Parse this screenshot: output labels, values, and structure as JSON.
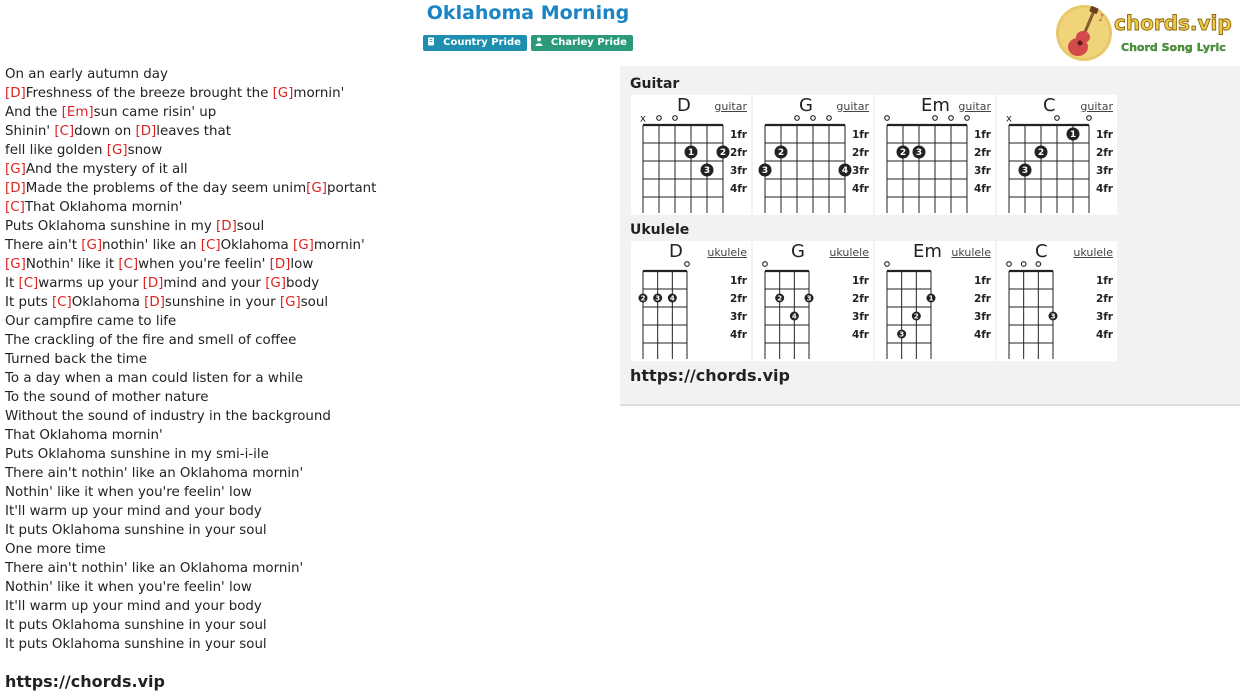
{
  "song": {
    "title": "Oklahoma Morning"
  },
  "badges": {
    "genre": "Country Pride",
    "artist": "Charley Pride"
  },
  "logo": {
    "brand": "chords.vip",
    "tagline": "Chord Song Lyric"
  },
  "lyrics": {
    "lines": [
      [
        {
          "t": "On an early autumn day"
        }
      ],
      [
        {
          "c": "[D]"
        },
        {
          "t": "Freshness of the breeze brought the "
        },
        {
          "c": "[G]"
        },
        {
          "t": "mornin'"
        }
      ],
      [
        {
          "t": "And the "
        },
        {
          "c": "[Em]"
        },
        {
          "t": "sun came risin' up"
        }
      ],
      [
        {
          "t": "Shinin' "
        },
        {
          "c": "[C]"
        },
        {
          "t": "down on "
        },
        {
          "c": "[D]"
        },
        {
          "t": "leaves that"
        }
      ],
      [
        {
          "t": "fell like golden "
        },
        {
          "c": "[G]"
        },
        {
          "t": "snow"
        }
      ],
      [
        {
          "c": "[G]"
        },
        {
          "t": "And the mystery of it all"
        }
      ],
      [
        {
          "c": "[D]"
        },
        {
          "t": "Made the problems of the day seem unim"
        },
        {
          "c": "[G]"
        },
        {
          "t": "portant"
        }
      ],
      [
        {
          "c": "[C]"
        },
        {
          "t": "That Oklahoma mornin'"
        }
      ],
      [
        {
          "t": "Puts Oklahoma sunshine in my "
        },
        {
          "c": "[D]"
        },
        {
          "t": "soul"
        }
      ],
      [
        {
          "t": "There ain't "
        },
        {
          "c": "[G]"
        },
        {
          "t": "nothin' like an "
        },
        {
          "c": "[C]"
        },
        {
          "t": "Oklahoma "
        },
        {
          "c": "[G]"
        },
        {
          "t": "mornin'"
        }
      ],
      [
        {
          "c": "[G]"
        },
        {
          "t": "Nothin' like it "
        },
        {
          "c": "[C]"
        },
        {
          "t": "when you're feelin' "
        },
        {
          "c": "[D]"
        },
        {
          "t": "low"
        }
      ],
      [
        {
          "t": "It "
        },
        {
          "c": "[C]"
        },
        {
          "t": "warms up your "
        },
        {
          "c": "[D]"
        },
        {
          "t": "mind and your "
        },
        {
          "c": "[G]"
        },
        {
          "t": "body"
        }
      ],
      [
        {
          "t": "It puts "
        },
        {
          "c": "[C]"
        },
        {
          "t": "Oklahoma "
        },
        {
          "c": "[D]"
        },
        {
          "t": "sunshine in your "
        },
        {
          "c": "[G]"
        },
        {
          "t": "soul"
        }
      ],
      [
        {
          "t": "Our campfire came to life"
        }
      ],
      [
        {
          "t": "The crackling of the fire and smell of coffee"
        }
      ],
      [
        {
          "t": "Turned back the time"
        }
      ],
      [
        {
          "t": "To a day when a man could listen for a while"
        }
      ],
      [
        {
          "t": "To the sound of mother nature"
        }
      ],
      [
        {
          "t": "Without the sound of industry in the background"
        }
      ],
      [
        {
          "t": "That Oklahoma mornin'"
        }
      ],
      [
        {
          "t": "Puts Oklahoma sunshine in my smi-i-ile"
        }
      ],
      [
        {
          "t": "There ain't nothin' like an Oklahoma mornin'"
        }
      ],
      [
        {
          "t": "Nothin' like it when you're feelin' low"
        }
      ],
      [
        {
          "t": "It'll warm up your mind and your body"
        }
      ],
      [
        {
          "t": "It puts Oklahoma sunshine in your soul"
        }
      ],
      [
        {
          "t": "One more time"
        }
      ],
      [
        {
          "t": "There ain't nothin' like an Oklahoma mornin'"
        }
      ],
      [
        {
          "t": "Nothin' like it when you're feelin' low"
        }
      ],
      [
        {
          "t": "It'll warm up your mind and your body"
        }
      ],
      [
        {
          "t": "It puts Oklahoma sunshine in your soul"
        }
      ],
      [
        {
          "t": "It puts Oklahoma sunshine in your soul"
        }
      ]
    ],
    "source_url": "https://chords.vip"
  },
  "chords_panel": {
    "guitar_label": "Guitar",
    "ukulele_label": "Ukulele",
    "source_url": "https://chords.vip",
    "fret_labels": [
      "1fr",
      "2fr",
      "3fr",
      "4fr"
    ],
    "guitar": [
      {
        "name": "D",
        "link": "guitar",
        "marks": [
          "x",
          "o",
          "o",
          "",
          "",
          ""
        ],
        "dots": [
          [
            3,
            2,
            "1"
          ],
          [
            5,
            2,
            "2"
          ],
          [
            4,
            3,
            "3"
          ]
        ]
      },
      {
        "name": "G",
        "link": "guitar",
        "marks": [
          "",
          "",
          "o",
          "o",
          "o",
          ""
        ],
        "dots": [
          [
            1,
            2,
            "2"
          ],
          [
            0,
            3,
            "3"
          ],
          [
            5,
            3,
            "4"
          ]
        ]
      },
      {
        "name": "Em",
        "link": "guitar",
        "marks": [
          "o",
          "",
          "",
          "o",
          "o",
          "o"
        ],
        "dots": [
          [
            1,
            2,
            "2"
          ],
          [
            2,
            2,
            "3"
          ]
        ]
      },
      {
        "name": "C",
        "link": "guitar",
        "marks": [
          "x",
          "",
          "",
          "o",
          "",
          "o"
        ],
        "dots": [
          [
            4,
            1,
            "1"
          ],
          [
            2,
            2,
            "2"
          ],
          [
            1,
            3,
            "3"
          ]
        ]
      }
    ],
    "ukulele": [
      {
        "name": "D",
        "link": "ukulele",
        "marks": [
          "",
          "",
          "",
          "o"
        ],
        "dots": [
          [
            0,
            2,
            "2"
          ],
          [
            1,
            2,
            "3"
          ],
          [
            2,
            2,
            "4"
          ]
        ]
      },
      {
        "name": "G",
        "link": "ukulele",
        "marks": [
          "o",
          "",
          "",
          ""
        ],
        "dots": [
          [
            1,
            2,
            "2"
          ],
          [
            3,
            2,
            "3"
          ],
          [
            2,
            3,
            "4"
          ]
        ]
      },
      {
        "name": "Em",
        "link": "ukulele",
        "marks": [
          "o",
          "",
          "",
          ""
        ],
        "dots": [
          [
            3,
            2,
            "1"
          ],
          [
            2,
            3,
            "2"
          ],
          [
            1,
            4,
            "3"
          ]
        ]
      },
      {
        "name": "C",
        "link": "ukulele",
        "marks": [
          "o",
          "o",
          "o",
          ""
        ],
        "dots": [
          [
            3,
            3,
            "3"
          ]
        ]
      }
    ]
  }
}
